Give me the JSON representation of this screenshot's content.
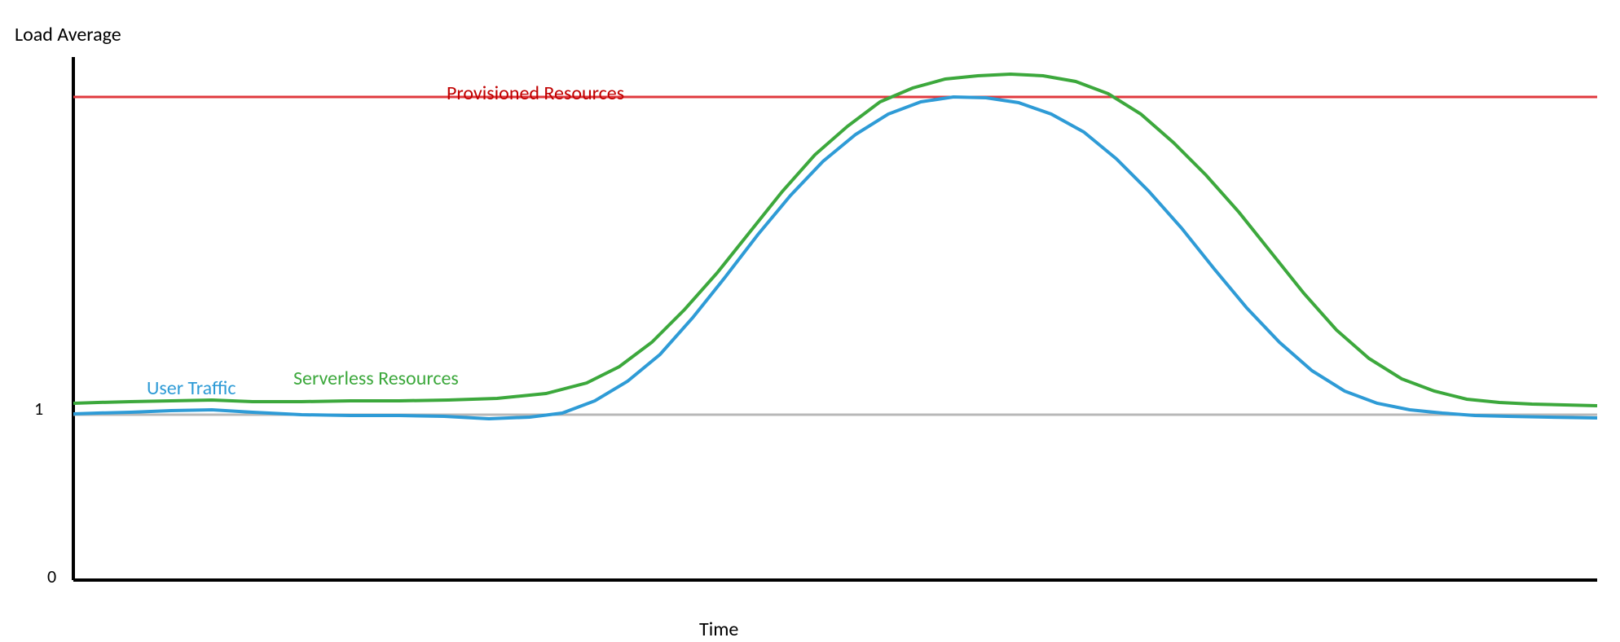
{
  "chart_data": {
    "type": "line",
    "title": "",
    "xlabel": "Time",
    "ylabel": "Load Average",
    "x": [
      0,
      1,
      2,
      3,
      4,
      5,
      6,
      7,
      8,
      9,
      10,
      11,
      12,
      13,
      14,
      15,
      16,
      17,
      18,
      19,
      20,
      21,
      22,
      23,
      24,
      25,
      26,
      27,
      28,
      29
    ],
    "series": [
      {
        "name": "User Traffic",
        "color": "#2e9bd6",
        "values": [
          1.02,
          1.03,
          1.04,
          1.05,
          1.03,
          1.01,
          1.0,
          1.0,
          1.01,
          1.0,
          1.02,
          1.25,
          1.7,
          2.3,
          2.8,
          3.1,
          3.23,
          3.23,
          3.18,
          3.05,
          2.85,
          2.55,
          2.2,
          1.8,
          1.45,
          1.2,
          1.08,
          1.02,
          1.0,
          0.99
        ]
      },
      {
        "name": "Serverless Resources",
        "color": "#3ca83c",
        "values": [
          1.08,
          1.09,
          1.09,
          1.1,
          1.09,
          1.08,
          1.08,
          1.08,
          1.09,
          1.1,
          1.12,
          1.35,
          1.8,
          2.4,
          2.9,
          3.2,
          3.35,
          3.38,
          3.35,
          3.22,
          3.0,
          2.72,
          2.38,
          1.98,
          1.62,
          1.35,
          1.2,
          1.12,
          1.08,
          1.06
        ]
      },
      {
        "name": "Provisioned Resources",
        "color": "#e0393e",
        "values": [
          3.23,
          3.23,
          3.23,
          3.23,
          3.23,
          3.23,
          3.23,
          3.23,
          3.23,
          3.23,
          3.23,
          3.23,
          3.23,
          3.23,
          3.23,
          3.23,
          3.23,
          3.23,
          3.23,
          3.23,
          3.23,
          3.23,
          3.23,
          3.23,
          3.23,
          3.23,
          3.23,
          3.23,
          3.23,
          3.23
        ]
      }
    ],
    "ylim": [
      0,
      3.5
    ],
    "y_ticks": [
      0,
      1
    ],
    "gridline_at": 1,
    "labels": {
      "provisioned": "Provisioned Resources",
      "user_traffic": "User Traffic",
      "serverless": "Serverless Resources"
    }
  }
}
